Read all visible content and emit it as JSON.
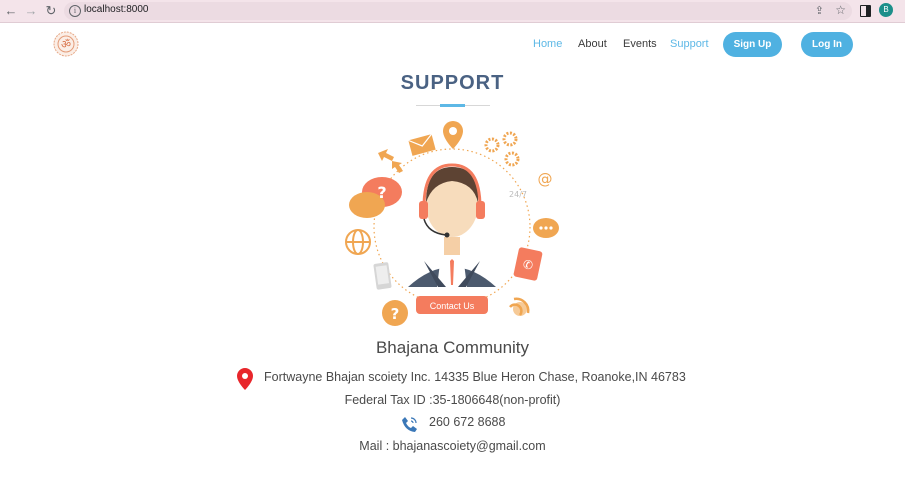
{
  "browser": {
    "back_icon": "←",
    "forward_icon": "→",
    "reload_icon": "↻",
    "url": "localhost:8000",
    "profile_initial": "B"
  },
  "nav": {
    "home": "Home",
    "about": "About",
    "events": "Events",
    "support": "Support",
    "signup": "Sign Up",
    "login": "Log In"
  },
  "main": {
    "title": "SUPPORT",
    "contact_button": "Contact Us",
    "org_name": "Bhajana Community",
    "address": "Fortwayne Bhajan scoiety Inc. 14335 Blue Heron Chase, Roanoke,IN 46783",
    "tax_id": "Federal Tax ID :35-1806648(non-profit)",
    "phone": "260 672 8688",
    "mail": "Mail : bhajanascoiety@gmail.com"
  },
  "colors": {
    "accent": "#5db8e6",
    "button": "#4fb1e1",
    "title": "#4a6283",
    "illustration_orange": "#f0a652",
    "contact_button": "#f47c5e",
    "pin": "#e8262b"
  }
}
